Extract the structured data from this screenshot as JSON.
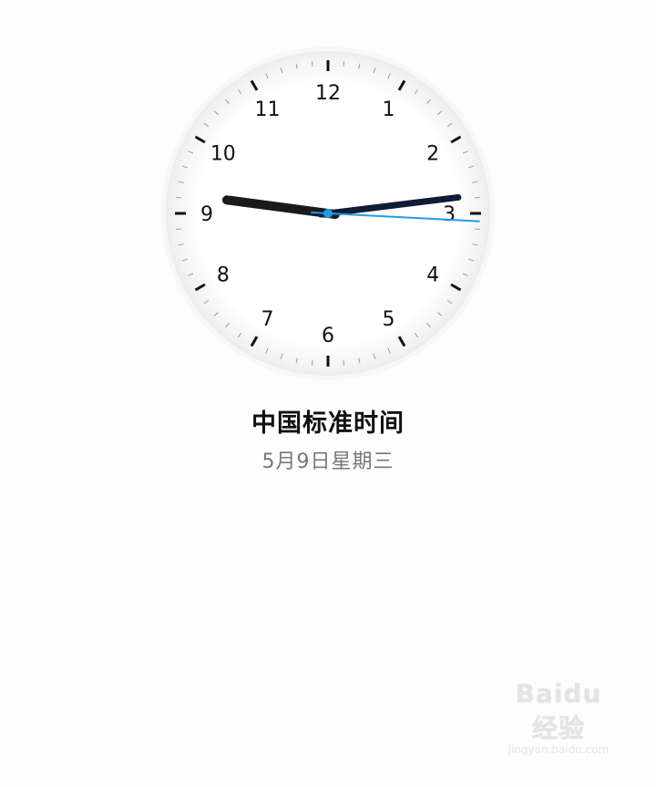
{
  "clock": {
    "numerals": [
      "12",
      "1",
      "2",
      "3",
      "4",
      "5",
      "6",
      "7",
      "8",
      "9",
      "10",
      "11"
    ],
    "hour": 2,
    "minute": 46,
    "second": 15.5,
    "hour_hand_color": "#0f1c36",
    "minute_hand_color": "#1a1a1a",
    "second_hand_color": "#1f9be6"
  },
  "timezone": {
    "name": "中国标准时间",
    "date": "5月9日星期三"
  },
  "watermark": {
    "logo": "Baidu 经验",
    "url": "jingyan.baidu.com"
  }
}
